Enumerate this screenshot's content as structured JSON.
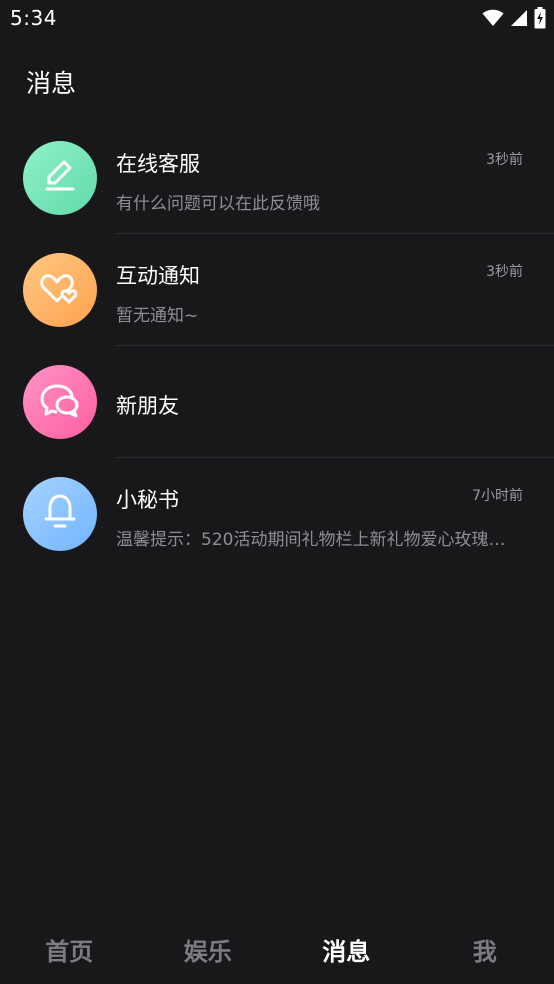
{
  "status_bar": {
    "time": "5:34",
    "icons": [
      "wifi-icon",
      "cell-signal-icon",
      "battery-charging-icon"
    ]
  },
  "header": {
    "title": "消息"
  },
  "messages": [
    {
      "title": "在线客服",
      "time": "3秒前",
      "preview": "有什么问题可以在此反馈哦",
      "icon": "pencil-icon",
      "gradient": [
        "#86f0c3",
        "#5fd8a8"
      ]
    },
    {
      "title": "互动通知",
      "time": "3秒前",
      "preview": "暂无通知~",
      "icon": "hearts-icon",
      "gradient": [
        "#ffc17a",
        "#ff9f4f"
      ]
    },
    {
      "title": "新朋友",
      "time": "",
      "preview": "",
      "icon": "chat-bubbles-icon",
      "gradient": [
        "#ff8ac2",
        "#ff5f9e"
      ]
    },
    {
      "title": "小秘书",
      "time": "7小时前",
      "preview": "温馨提示：520活动期间礼物栏上新礼物爱心玫瑰…",
      "icon": "bell-icon",
      "gradient": [
        "#9fd0ff",
        "#6fb2ff"
      ]
    }
  ],
  "bottom_nav": {
    "items": [
      {
        "label": "首页",
        "active": false
      },
      {
        "label": "娱乐",
        "active": false
      },
      {
        "label": "消息",
        "active": true
      },
      {
        "label": "我",
        "active": false
      }
    ]
  },
  "colors": {
    "background": "#18171a",
    "nav_inactive": "#7d7c80",
    "nav_active": "#ffffff"
  }
}
